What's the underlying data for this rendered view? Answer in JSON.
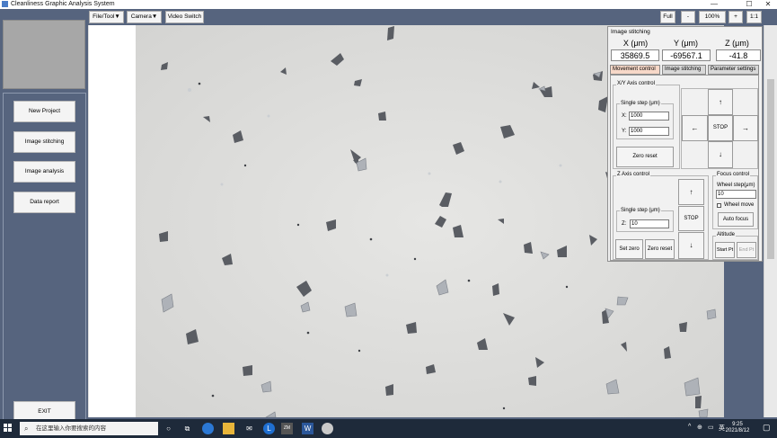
{
  "window": {
    "title": "Cleanliness Graphic Analysis System",
    "controls": [
      "—",
      "☐",
      "✕"
    ]
  },
  "sidebar": {
    "buttons": [
      {
        "label": "New Project"
      },
      {
        "label": "Image stitching"
      },
      {
        "label": "Image analysis"
      },
      {
        "label": "Data report"
      }
    ],
    "exit_label": "EXIT"
  },
  "toolbar": {
    "menus": [
      {
        "label": "File/Tool▼"
      },
      {
        "label": "Camera▼"
      },
      {
        "label": "Video Switch"
      }
    ],
    "zoom": {
      "full": "Full",
      "minus": "-",
      "level": "100%",
      "plus": "+",
      "one_to_one": "1:1"
    }
  },
  "stitch_panel": {
    "title": "Image stitching",
    "x_label": "X (μm)",
    "y_label": "Y (μm)",
    "z_label": "Z (μm)",
    "x_value": "35869.5",
    "y_value": "-69567.1",
    "z_value": "-41.8",
    "tabs": [
      {
        "label": "Movement control"
      },
      {
        "label": "Image stitching"
      },
      {
        "label": "Parameter settings"
      }
    ],
    "xy": {
      "group_label": "X/Y Axis control",
      "step_label": "Single step (μm)",
      "x_label": "X:",
      "x_value": "1000",
      "y_label": "Y:",
      "y_value": "1000",
      "zero_reset": "Zero reset",
      "up": "↑",
      "down": "↓",
      "left": "←",
      "right": "→",
      "stop": "STOP"
    },
    "z": {
      "group_label": "Z Axis control",
      "step_label": "Single step (μm)",
      "z_label": "Z:",
      "z_value": "10",
      "set_zero": "Set zero",
      "zero_reset": "Zero reset",
      "up": "↑",
      "down": "↓",
      "stop": "STOP"
    },
    "focus": {
      "group_label": "Focus control",
      "wheel_step_label": "Wheel step(μm)",
      "wheel_step_value": "10",
      "wheel_move_label": "Wheel move",
      "auto_focus": "Auto focus"
    },
    "altitude": {
      "group_label": "Altitude",
      "start": "Start Pt",
      "end": "End Pt"
    }
  },
  "taskbar": {
    "search_placeholder": "在这里输入你要搜索的内容",
    "time": "9:25",
    "date": "2021/8/12",
    "tray_lang": "英"
  }
}
